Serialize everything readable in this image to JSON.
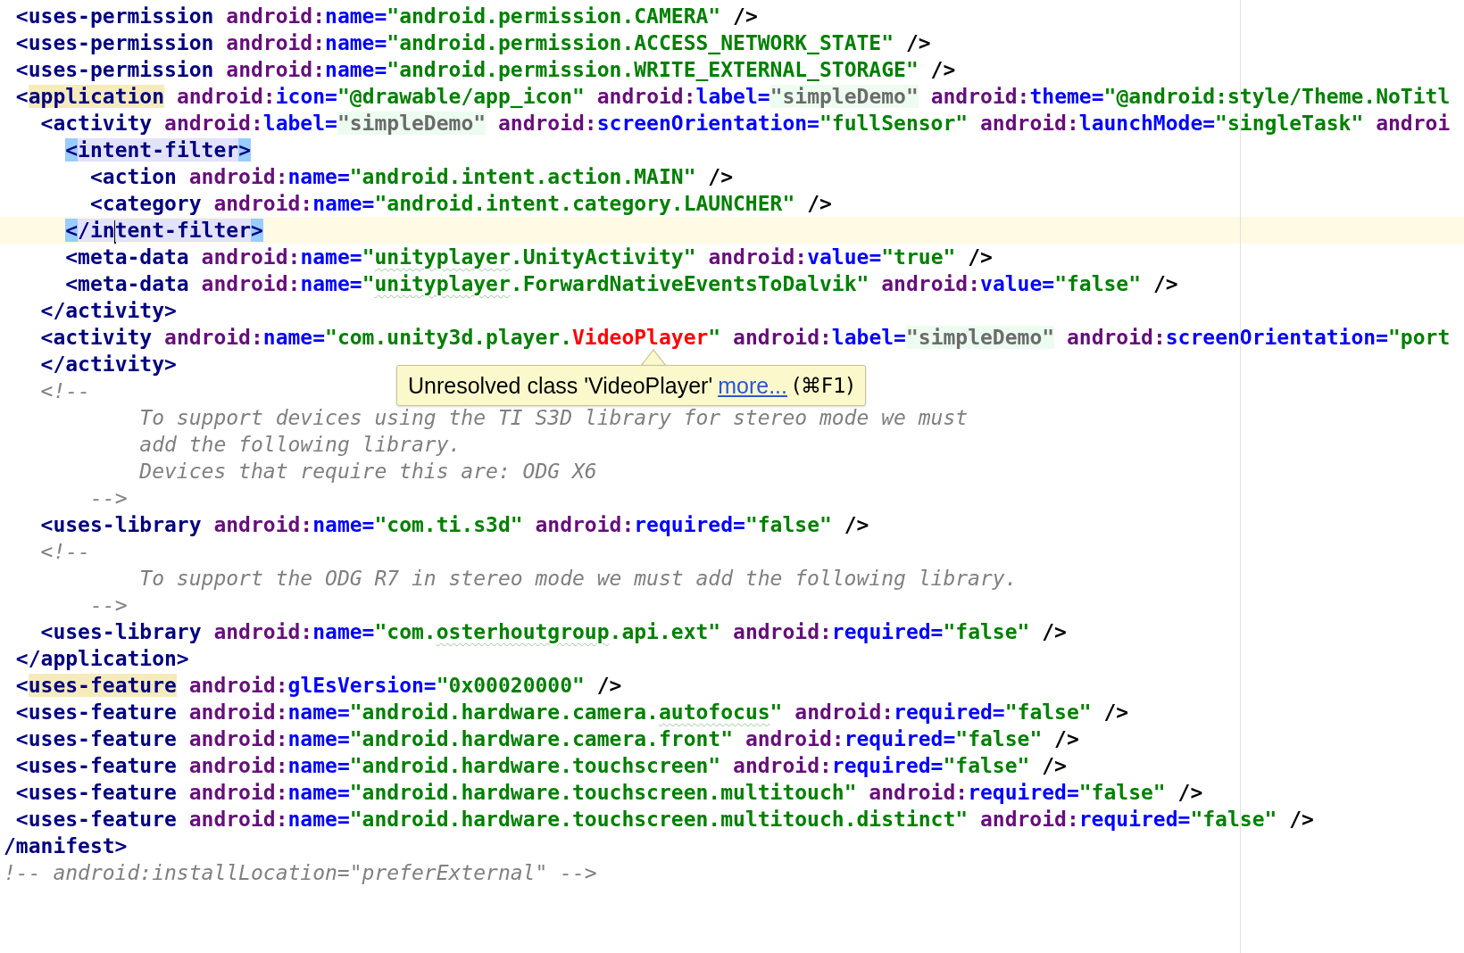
{
  "editor": {
    "lines": [
      {
        "current": false,
        "tokens": [
          {
            "text": " <uses-permission",
            "kind": "tag"
          },
          {
            "text": " android:",
            "kind": "ns"
          },
          {
            "text": "name=",
            "kind": "attr"
          },
          {
            "text": "\"android.permission.CAMERA\"",
            "kind": "value"
          },
          {
            "text": " />",
            "kind": "punct"
          }
        ]
      },
      {
        "current": false,
        "tokens": [
          {
            "text": " <uses-permission",
            "kind": "tag"
          },
          {
            "text": " android:",
            "kind": "ns"
          },
          {
            "text": "name=",
            "kind": "attr"
          },
          {
            "text": "\"android.permission.ACCESS_NETWORK_STATE\"",
            "kind": "value"
          },
          {
            "text": " />",
            "kind": "punct"
          }
        ]
      },
      {
        "current": false,
        "tokens": [
          {
            "text": " <uses-permission",
            "kind": "tag"
          },
          {
            "text": " android:",
            "kind": "ns"
          },
          {
            "text": "name=",
            "kind": "attr"
          },
          {
            "text": "\"android.permission.WRITE_EXTERNAL_STORAGE\"",
            "kind": "value"
          },
          {
            "text": " />",
            "kind": "punct"
          }
        ]
      },
      {
        "current": false,
        "tokens": [
          {
            "text": " <",
            "kind": "tag"
          },
          {
            "text": "application",
            "kind": "tag",
            "color": "#f6ebbc"
          },
          {
            "text": " android:",
            "kind": "ns"
          },
          {
            "text": "icon=",
            "kind": "attr"
          },
          {
            "text": "\"@drawable/app_icon\"",
            "kind": "value"
          },
          {
            "text": " android:",
            "kind": "ns"
          },
          {
            "text": "label=",
            "kind": "attr"
          },
          {
            "text": "\"simpleDemo\"",
            "kind": "ref",
            "color": "#edfcf0"
          },
          {
            "text": " android:",
            "kind": "ns"
          },
          {
            "text": "theme=",
            "kind": "attr"
          },
          {
            "text": "\"@android:style/Theme.NoTitl",
            "kind": "value"
          }
        ]
      },
      {
        "current": false,
        "tokens": [
          {
            "text": "   <activity",
            "kind": "tag"
          },
          {
            "text": " android:",
            "kind": "ns"
          },
          {
            "text": "label=",
            "kind": "attr"
          },
          {
            "text": "\"simpleDemo\"",
            "kind": "ref",
            "color": "#edfcf0"
          },
          {
            "text": " android:",
            "kind": "ns"
          },
          {
            "text": "screenOrientation=",
            "kind": "attr"
          },
          {
            "text": "\"fullSensor\"",
            "kind": "value"
          },
          {
            "text": " android:",
            "kind": "ns"
          },
          {
            "text": "launchMode=",
            "kind": "attr"
          },
          {
            "text": "\"singleTask\"",
            "kind": "value"
          },
          {
            "text": " androi",
            "kind": "ns"
          }
        ]
      },
      {
        "current": false,
        "tokens": [
          {
            "text": "     <",
            "kind": "tag",
            "color": "#99ccff"
          },
          {
            "text": "intent-filter",
            "kind": "tag",
            "color": "#e2e2fb"
          },
          {
            "text": ">",
            "kind": "tag",
            "color": "#99ccff"
          }
        ]
      },
      {
        "current": false,
        "tokens": [
          {
            "text": "       <action",
            "kind": "tag"
          },
          {
            "text": " android:",
            "kind": "ns"
          },
          {
            "text": "name=",
            "kind": "attr"
          },
          {
            "text": "\"android.intent.action.MAIN\"",
            "kind": "value"
          },
          {
            "text": " />",
            "kind": "punct"
          }
        ]
      },
      {
        "current": false,
        "tokens": [
          {
            "text": "       <category",
            "kind": "tag"
          },
          {
            "text": " android:",
            "kind": "ns"
          },
          {
            "text": "name=",
            "kind": "attr"
          },
          {
            "text": "\"android.intent.category.LAUNCHER\"",
            "kind": "value"
          },
          {
            "text": " />",
            "kind": "punct"
          }
        ]
      },
      {
        "current": true,
        "tokens": [
          {
            "text": "     <",
            "kind": "tag",
            "color": "#99ccff"
          },
          {
            "text": "/in",
            "kind": "tag",
            "color": "#e2e2fb",
            "caret": true
          },
          {
            "text": "tent-filter",
            "kind": "tag",
            "color": "#e2e2fb"
          },
          {
            "text": ">",
            "kind": "tag",
            "color": "#99ccff"
          }
        ]
      },
      {
        "current": false,
        "tokens": [
          {
            "text": "     <meta-data",
            "kind": "tag"
          },
          {
            "text": " android:",
            "kind": "ns"
          },
          {
            "text": "name=",
            "kind": "attr"
          },
          {
            "text": "\"",
            "kind": "value"
          },
          {
            "text": "unityplayer",
            "kind": "value",
            "typo": true
          },
          {
            "text": ".UnityActivity\"",
            "kind": "value"
          },
          {
            "text": " android:",
            "kind": "ns"
          },
          {
            "text": "value=",
            "kind": "attr"
          },
          {
            "text": "\"true\"",
            "kind": "value"
          },
          {
            "text": " />",
            "kind": "punct"
          }
        ]
      },
      {
        "current": false,
        "tokens": [
          {
            "text": "     <meta-data",
            "kind": "tag"
          },
          {
            "text": " android:",
            "kind": "ns"
          },
          {
            "text": "name=",
            "kind": "attr"
          },
          {
            "text": "\"",
            "kind": "value"
          },
          {
            "text": "unityplayer",
            "kind": "value",
            "typo": true
          },
          {
            "text": ".ForwardNativeEventsToDalvik\"",
            "kind": "value"
          },
          {
            "text": " android:",
            "kind": "ns"
          },
          {
            "text": "value=",
            "kind": "attr"
          },
          {
            "text": "\"false\"",
            "kind": "value"
          },
          {
            "text": " />",
            "kind": "punct"
          }
        ]
      },
      {
        "current": false,
        "tokens": [
          {
            "text": "   </activity>",
            "kind": "tag"
          }
        ]
      },
      {
        "current": false,
        "tokens": [
          {
            "text": "   <activity",
            "kind": "tag"
          },
          {
            "text": " android:",
            "kind": "ns"
          },
          {
            "text": "name=",
            "kind": "attr"
          },
          {
            "text": "\"com.unity3d.player.",
            "kind": "value"
          },
          {
            "text": "VideoPlayer",
            "kind": "error"
          },
          {
            "text": "\"",
            "kind": "value"
          },
          {
            "text": " android:",
            "kind": "ns"
          },
          {
            "text": "label=",
            "kind": "attr"
          },
          {
            "text": "\"simpleDemo\"",
            "kind": "ref",
            "color": "#edfcf0"
          },
          {
            "text": " android:",
            "kind": "ns"
          },
          {
            "text": "screenOrientation=",
            "kind": "attr"
          },
          {
            "text": "\"port",
            "kind": "value"
          }
        ]
      },
      {
        "current": false,
        "tokens": [
          {
            "text": "   </activity>",
            "kind": "tag"
          }
        ]
      },
      {
        "current": false,
        "tokens": [
          {
            "text": "   <!--",
            "kind": "comment"
          }
        ]
      },
      {
        "current": false,
        "tokens": [
          {
            "text": "           To support devices using the TI S3D library for stereo mode we must",
            "kind": "comment"
          }
        ]
      },
      {
        "current": false,
        "tokens": [
          {
            "text": "           add the following library.",
            "kind": "comment"
          }
        ]
      },
      {
        "current": false,
        "tokens": [
          {
            "text": "           Devices that require this are: ODG X6",
            "kind": "comment"
          }
        ]
      },
      {
        "current": false,
        "tokens": [
          {
            "text": "       -->",
            "kind": "comment"
          }
        ]
      },
      {
        "current": false,
        "tokens": [
          {
            "text": "   <uses-library",
            "kind": "tag"
          },
          {
            "text": " android:",
            "kind": "ns"
          },
          {
            "text": "name=",
            "kind": "attr"
          },
          {
            "text": "\"com.ti.s3d\"",
            "kind": "value"
          },
          {
            "text": " android:",
            "kind": "ns"
          },
          {
            "text": "required=",
            "kind": "attr"
          },
          {
            "text": "\"false\"",
            "kind": "value"
          },
          {
            "text": " />",
            "kind": "punct"
          }
        ]
      },
      {
        "current": false,
        "tokens": [
          {
            "text": "   <!--",
            "kind": "comment"
          }
        ]
      },
      {
        "current": false,
        "tokens": [
          {
            "text": "           To support the ODG R7 in stereo mode we must add the following library.",
            "kind": "comment"
          }
        ]
      },
      {
        "current": false,
        "tokens": [
          {
            "text": "       -->",
            "kind": "comment"
          }
        ]
      },
      {
        "current": false,
        "tokens": [
          {
            "text": "   <uses-library",
            "kind": "tag"
          },
          {
            "text": " android:",
            "kind": "ns"
          },
          {
            "text": "name=",
            "kind": "attr"
          },
          {
            "text": "\"com.",
            "kind": "value"
          },
          {
            "text": "osterhoutgroup",
            "kind": "value",
            "typo": true
          },
          {
            "text": ".api.ext\"",
            "kind": "value"
          },
          {
            "text": " android:",
            "kind": "ns"
          },
          {
            "text": "required=",
            "kind": "attr"
          },
          {
            "text": "\"false\"",
            "kind": "value"
          },
          {
            "text": " />",
            "kind": "punct"
          }
        ]
      },
      {
        "current": false,
        "tokens": [
          {
            "text": " </application>",
            "kind": "tag"
          }
        ]
      },
      {
        "current": false,
        "tokens": [
          {
            "text": " <",
            "kind": "tag"
          },
          {
            "text": "uses-feature",
            "kind": "tag",
            "color": "#f6ebbc"
          },
          {
            "text": " android:",
            "kind": "ns"
          },
          {
            "text": "glEsVersion=",
            "kind": "attr"
          },
          {
            "text": "\"0x00020000\"",
            "kind": "value"
          },
          {
            "text": " />",
            "kind": "punct"
          }
        ]
      },
      {
        "current": false,
        "tokens": [
          {
            "text": " <uses-feature",
            "kind": "tag"
          },
          {
            "text": " android:",
            "kind": "ns"
          },
          {
            "text": "name=",
            "kind": "attr"
          },
          {
            "text": "\"android.hardware.camera.",
            "kind": "value"
          },
          {
            "text": "autofocus",
            "kind": "value",
            "typo": true
          },
          {
            "text": "\"",
            "kind": "value"
          },
          {
            "text": " android:",
            "kind": "ns"
          },
          {
            "text": "required=",
            "kind": "attr"
          },
          {
            "text": "\"false\"",
            "kind": "value"
          },
          {
            "text": " />",
            "kind": "punct"
          }
        ]
      },
      {
        "current": false,
        "tokens": [
          {
            "text": " <uses-feature",
            "kind": "tag"
          },
          {
            "text": " android:",
            "kind": "ns"
          },
          {
            "text": "name=",
            "kind": "attr"
          },
          {
            "text": "\"android.hardware.camera.front\"",
            "kind": "value"
          },
          {
            "text": " android:",
            "kind": "ns"
          },
          {
            "text": "required=",
            "kind": "attr"
          },
          {
            "text": "\"false\"",
            "kind": "value"
          },
          {
            "text": " />",
            "kind": "punct"
          }
        ]
      },
      {
        "current": false,
        "tokens": [
          {
            "text": " <uses-feature",
            "kind": "tag"
          },
          {
            "text": " android:",
            "kind": "ns"
          },
          {
            "text": "name=",
            "kind": "attr"
          },
          {
            "text": "\"android.hardware.touchscreen\"",
            "kind": "value"
          },
          {
            "text": " android:",
            "kind": "ns"
          },
          {
            "text": "required=",
            "kind": "attr"
          },
          {
            "text": "\"false\"",
            "kind": "value"
          },
          {
            "text": " />",
            "kind": "punct"
          }
        ]
      },
      {
        "current": false,
        "tokens": [
          {
            "text": " <uses-feature",
            "kind": "tag"
          },
          {
            "text": " android:",
            "kind": "ns"
          },
          {
            "text": "name=",
            "kind": "attr"
          },
          {
            "text": "\"android.hardware.touchscreen.multitouch\"",
            "kind": "value"
          },
          {
            "text": " android:",
            "kind": "ns"
          },
          {
            "text": "required=",
            "kind": "attr"
          },
          {
            "text": "\"false\"",
            "kind": "value"
          },
          {
            "text": " />",
            "kind": "punct"
          }
        ]
      },
      {
        "current": false,
        "tokens": [
          {
            "text": " <uses-feature",
            "kind": "tag"
          },
          {
            "text": " android:",
            "kind": "ns"
          },
          {
            "text": "name=",
            "kind": "attr"
          },
          {
            "text": "\"android.hardware.touchscreen.multitouch.distinct\"",
            "kind": "value"
          },
          {
            "text": " android:",
            "kind": "ns"
          },
          {
            "text": "required=",
            "kind": "attr"
          },
          {
            "text": "\"false\"",
            "kind": "value"
          },
          {
            "text": " />",
            "kind": "punct"
          }
        ]
      },
      {
        "current": false,
        "tokens": [
          {
            "text": "/manifest>",
            "kind": "tag"
          }
        ]
      },
      {
        "current": false,
        "tokens": [
          {
            "text": "!-- android:installLocation=\"preferExternal\" -->",
            "kind": "comment"
          }
        ]
      }
    ],
    "tooltip": {
      "text": "Unresolved class 'VideoPlayer'",
      "link": "more...",
      "shortcut": "(⌘F1)"
    }
  }
}
